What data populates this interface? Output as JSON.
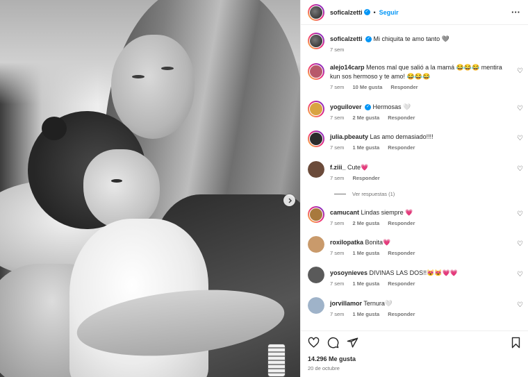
{
  "post": {
    "author": {
      "username": "soficalzetti",
      "verified": true,
      "follow_label": "Seguir",
      "separator": "•"
    },
    "caption": {
      "text": "Mi chiquita te amo tanto 🩶",
      "time": "7 sem"
    },
    "comments": [
      {
        "username": "alejo14carp",
        "verified": false,
        "text": "Menos mal que salió a la mamá 😂😂😂 mentira kun sos hermoso y te amo! 😂😂😂",
        "time": "7 sem",
        "likes": "10 Me gusta",
        "reply": "Responder",
        "avatar_color": "#b8596a"
      },
      {
        "username": "yoguilover",
        "verified": true,
        "text": "Hermosas 🤍",
        "time": "7 sem",
        "likes": "2 Me gusta",
        "reply": "Responder",
        "avatar_color": "#d9a441"
      },
      {
        "username": "julia.pbeauty",
        "verified": false,
        "text": "Las amo demasiado!!!!",
        "time": "7 sem",
        "likes": "1 Me gusta",
        "reply": "Responder",
        "avatar_color": "#2c2c2c"
      },
      {
        "username": "f.ziii_",
        "verified": false,
        "text": "Cute💗",
        "time": "7 sem",
        "likes": "",
        "reply": "Responder",
        "avatar_color": "#6b4b3a",
        "view_replies": "Ver respuestas (1)"
      },
      {
        "username": "camucant",
        "verified": false,
        "text": "Lindas siempre 💗",
        "time": "7 sem",
        "likes": "2 Me gusta",
        "reply": "Responder",
        "avatar_color": "#a8793d"
      },
      {
        "username": "roxilopatka",
        "verified": false,
        "text": "Bonita💗",
        "time": "7 sem",
        "likes": "1 Me gusta",
        "reply": "Responder",
        "avatar_color": "#c99a6b"
      },
      {
        "username": "yosoynieves",
        "verified": false,
        "text": "DIVINAS LAS DOS!!😻😻💗💗",
        "time": "7 sem",
        "likes": "1 Me gusta",
        "reply": "Responder",
        "avatar_color": "#5a5a5a"
      },
      {
        "username": "jorvillamor",
        "verified": false,
        "text": "Ternura🤍",
        "time": "7 sem",
        "likes": "1 Me gusta",
        "reply": "Responder",
        "avatar_color": "#9fb3c9"
      }
    ],
    "likes_count": "14.296 Me gusta",
    "date": "20 de octubre",
    "icons": {
      "more": "more-options-icon",
      "next": "chevron-right-icon",
      "like": "heart-icon",
      "comment": "comment-icon",
      "share": "share-icon",
      "save": "bookmark-icon"
    }
  }
}
